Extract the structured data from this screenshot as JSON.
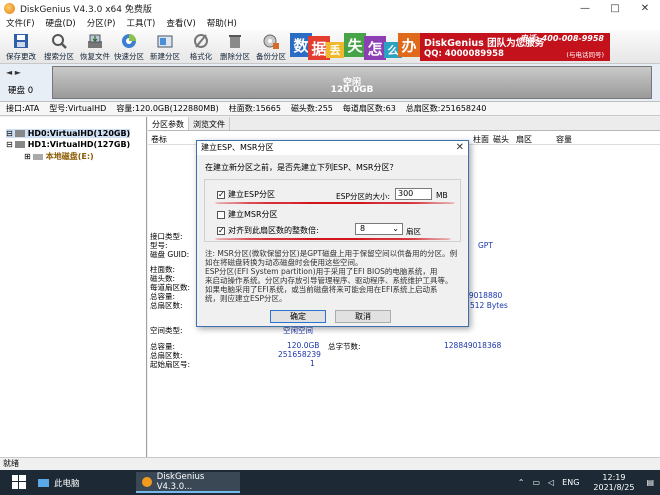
{
  "window": {
    "title": "DiskGenius V4.3.0 x64 免费版",
    "controls": [
      "—",
      "□",
      "✕"
    ]
  },
  "menu": [
    "文件(F)",
    "硬盘(D)",
    "分区(P)",
    "工具(T)",
    "查看(V)",
    "帮助(H)"
  ],
  "toolbar": [
    {
      "label": "保存更改",
      "icon": "save-icon"
    },
    {
      "label": "搜索分区",
      "icon": "search-icon"
    },
    {
      "label": "恢复文件",
      "icon": "restore-file-icon"
    },
    {
      "label": "快速分区",
      "icon": "quick-partition-icon"
    },
    {
      "label": "新建分区",
      "icon": "new-partition-icon"
    },
    {
      "label": "格式化",
      "icon": "format-icon"
    },
    {
      "label": "删除分区",
      "icon": "delete-icon"
    },
    {
      "label": "备份分区",
      "icon": "backup-icon"
    }
  ],
  "ad": {
    "tiles": [
      "数",
      "据",
      "丢",
      "失",
      "怎",
      "么",
      "办"
    ],
    "line1": "DiskGenius 团队为您服务",
    "line2": "电话: 400-008-9958",
    "line3": "QQ: 4000089958",
    "line4": "(与电话同号)"
  },
  "diskmap": {
    "nav": "◄ ►",
    "disk_label": "硬盘 0",
    "bar_line1": "空闲",
    "bar_line2": "120.0GB"
  },
  "infobar": {
    "iface": "接口:ATA",
    "model": "型号:VirtualHD",
    "capacity": "容量:120.0GB(122880MB)",
    "cylinders": "柱面数:15665",
    "heads": "磁头数:255",
    "sectors": "每道扇区数:63",
    "total": "总扇区数:251658240"
  },
  "tree": {
    "hd0": "HD0:VirtualHD(120GB)",
    "hd1": "HD1:VirtualHD(127GB)",
    "local": "本地磁盘(E:)"
  },
  "right": {
    "tabs": [
      "分区参数",
      "浏览文件"
    ],
    "columns": [
      "卷标",
      "柱面",
      "磁头",
      "扇区",
      "容量"
    ],
    "labels": {
      "iface": "接口类型:",
      "model": "型号:",
      "guid": "磁盘 GUID:",
      "cyl": "柱面数:",
      "heads": "磁头数:",
      "spt": "每道扇区数:",
      "cap": "总容量:",
      "total_sec": "总扇区数:",
      "space_type": "空间类型:",
      "cap2": "总容量:",
      "total_sec2": "总扇区数:",
      "start": "起始扇区号:",
      "total_bytes": "总字节数:"
    },
    "values": {
      "gpt": "GPT",
      "bytes_val": "128849018880",
      "sector_size": "512 Bytes",
      "space": "空闲空间",
      "cap2": "120.0GB",
      "total_sec2": "251658239",
      "start": "1",
      "bytes2": "128849018368"
    }
  },
  "dialog": {
    "title": "建立ESP、MSR分区",
    "close": "✕",
    "prompt": "在建立新分区之前，是否先建立下列ESP、MSR分区？",
    "esp_label": "建立ESP分区",
    "esp_size_label": "ESP分区的大小:",
    "esp_size_value": "300",
    "esp_unit": "MB",
    "msr_label": "建立MSR分区",
    "align_label": "对齐到此扇区数的整数倍:",
    "align_value": "8",
    "align_unit": "扇区",
    "note1": "注: MSR分区(微软保留分区)是GPT磁盘上用于保留空间以供备用的分区。例",
    "note2": "如在将磁盘转换为动态磁盘时会使用这些空间。",
    "note3": "     ESP分区(EFI System partition)用于采用了EFI BIOS的电脑系统，用",
    "note4": "来启动操作系统。分区内存放引导管理程序、驱动程序、系统维护工具等。",
    "note5": "     如果电脑采用了EFI系统，或当前磁盘将来可能会用在EFI系统上启动系",
    "note6": "统，则应建立ESP分区。",
    "ok": "确定",
    "cancel": "取消"
  },
  "status": "就绪",
  "taskbar": {
    "item1": "此电脑",
    "item2": "DiskGenius V4.3.0...",
    "lang": "ENG",
    "time": "12:19",
    "date": "2021/8/25"
  }
}
